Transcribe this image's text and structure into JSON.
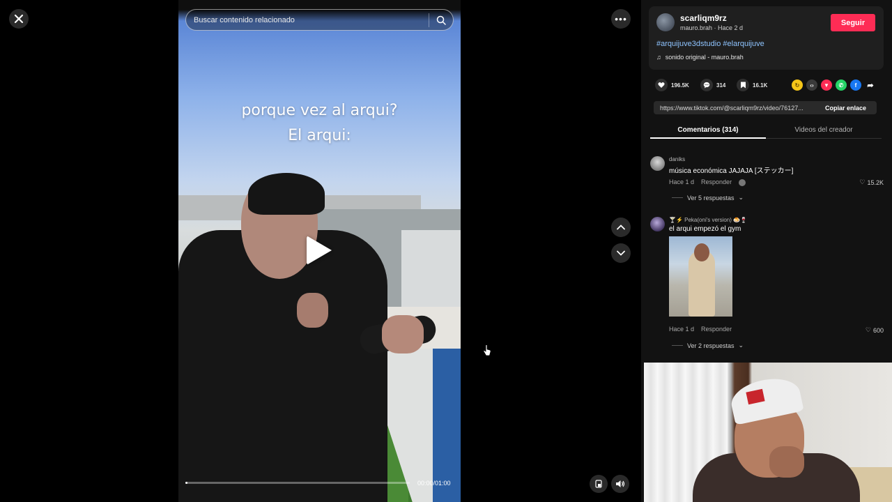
{
  "player": {
    "search_placeholder": "Buscar contenido relacionado",
    "caption_line1": "porque vez al arqui?",
    "caption_line2": "El arqui:",
    "time": "00:00/01:00",
    "progress": 0.01
  },
  "author": {
    "username": "scarliqm9rz",
    "subline": "mauro.brah · Hace 2 d",
    "follow_label": "Seguir",
    "hashtags": "#arquijuve3dstudio #elarquijuve",
    "sound": "sonido original - mauro.brah"
  },
  "stats": {
    "likes": "196.5K",
    "comments": "314",
    "saves": "16.1K"
  },
  "share": {
    "icons": [
      "embed-icon",
      "send-icon",
      "whatsapp-icon",
      "facebook-icon",
      "share-arrow-icon"
    ]
  },
  "link": {
    "url": "https://www.tiktok.com/@scarliqm9rz/video/76127...",
    "copy_label": "Copiar enlace"
  },
  "tabs": {
    "comments": "Comentarios (314)",
    "creator": "Videos del creador"
  },
  "comments": [
    {
      "user": "daniks",
      "text": "música económica JAJAJA [ステッカー]",
      "time": "Hace 1 d",
      "reply": "Responder",
      "likes": "15.2K",
      "replies": "Ver 5 respuestas"
    },
    {
      "user": "🍸⚡ Peka(oni's version) 🍮🍷",
      "text": "el arqui empezó el gym",
      "time": "Hace 1 d",
      "reply": "Responder",
      "likes": "600",
      "replies": "Ver 2 respuestas"
    }
  ],
  "colors": {
    "follow": "#fe2c55",
    "hashtag": "#8fc4ff"
  }
}
